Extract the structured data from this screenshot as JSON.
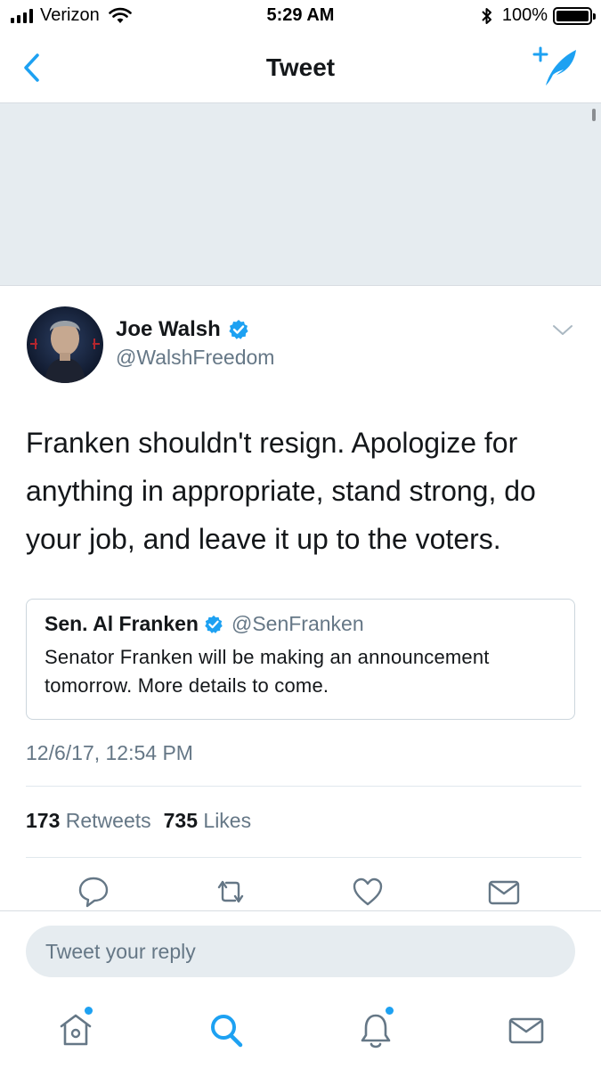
{
  "status_bar": {
    "carrier": "Verizon",
    "time": "5:29 AM",
    "battery": "100%",
    "battery_level": 1.0,
    "signal_bars": 4,
    "signal_total": 4
  },
  "nav": {
    "title": "Tweet",
    "back_icon": "chevron-left-icon",
    "compose_icon": "compose-tweet-icon"
  },
  "tweet": {
    "author": {
      "name": "Joe Walsh",
      "handle": "@WalshFreedom",
      "verified": true
    },
    "text": "Franken shouldn't resign. Apologize for anything in appropriate, stand strong, do your job, and leave it up to the voters.",
    "quote": {
      "name": "Sen. Al Franken",
      "handle": "@SenFranken",
      "verified": true,
      "text": "Senator Franken will be making an announcement tomorrow. More details to come."
    },
    "timestamp": "12/6/17, 12:54 PM",
    "stats": {
      "retweets_count": "173",
      "retweets_label": "Retweets",
      "likes_count": "735",
      "likes_label": "Likes"
    },
    "actions": [
      "reply-icon",
      "retweet-icon",
      "like-icon",
      "message-icon"
    ]
  },
  "reply": {
    "placeholder": "Tweet your reply"
  },
  "tab_bar": {
    "items": [
      "home-icon",
      "search-icon",
      "notifications-icon",
      "messages-icon"
    ]
  },
  "colors": {
    "accent": "#1da1f2",
    "text": "#14171a",
    "secondary": "#657786",
    "banner": "#e6ecf0"
  }
}
